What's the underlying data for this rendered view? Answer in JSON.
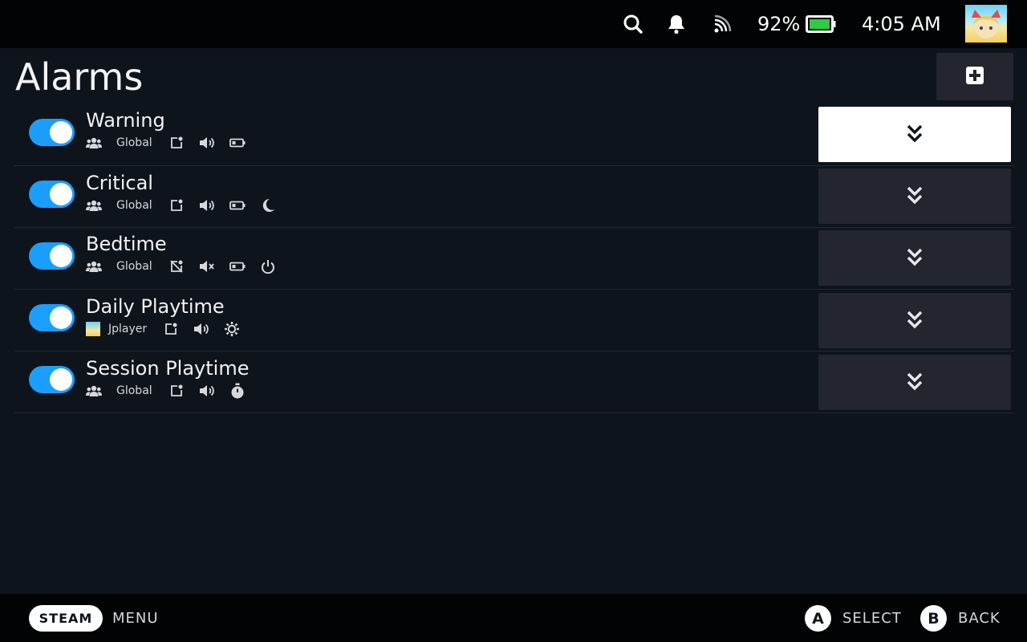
{
  "status_bar": {
    "battery_percent": "92%",
    "time": "4:05 AM",
    "battery_color": "#2ecc40"
  },
  "page": {
    "title": "Alarms",
    "add_icon": "plus-square-icon"
  },
  "alarms": [
    {
      "title": "Warning",
      "owner": "Global",
      "enabled": true,
      "icons": [
        "users-icon",
        "popup-icon",
        "volume-icon",
        "battery-low-icon"
      ]
    },
    {
      "title": "Critical",
      "owner": "Global",
      "enabled": true,
      "icons": [
        "users-icon",
        "popup-icon",
        "volume-icon",
        "battery-low-icon",
        "moon-icon"
      ]
    },
    {
      "title": "Bedtime",
      "owner": "Global",
      "enabled": true,
      "icons": [
        "users-icon",
        "popup-off-icon",
        "volume-mute-icon",
        "battery-low-icon",
        "power-icon"
      ]
    },
    {
      "title": "Daily Playtime",
      "owner": "Jplayer",
      "enabled": true,
      "icons": [
        "user-avatar",
        "popup-icon",
        "volume-icon",
        "sun-icon"
      ]
    },
    {
      "title": "Session Playtime",
      "owner": "Global",
      "enabled": true,
      "icons": [
        "users-icon",
        "popup-icon",
        "volume-icon",
        "stopwatch-icon"
      ]
    }
  ],
  "footer": {
    "steam_label": "STEAM",
    "menu_label": "MENU",
    "a_button": "A",
    "select_label": "SELECT",
    "b_button": "B",
    "back_label": "BACK"
  },
  "colors": {
    "accent": "#1a9fff",
    "background": "#0e141b",
    "panel": "#23262e"
  }
}
